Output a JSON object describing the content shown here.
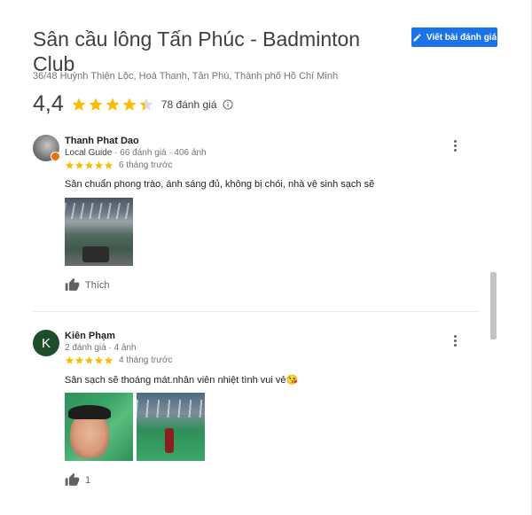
{
  "place": {
    "title": "Sân cầu lông Tấn Phúc - Badminton Club",
    "address": "36/48 Huỳnh Thiện Lộc, Hoà Thanh, Tân Phú, Thành phố Hồ Chí Minh",
    "rating": "4,4",
    "rating_stars": 4.4,
    "review_count": "78 đánh giá",
    "write_review_label": "Viết bài đánh giá"
  },
  "reviews": [
    {
      "name": "Thanh Phat Dao",
      "badge": "Local Guide",
      "meta": "· 66 đánh giá · 406 ảnh",
      "stars": 5,
      "date": "6 tháng trước",
      "text": "Sân chuẩn phong trào, ánh sáng đủ, không bị chói, nhà vệ sinh sạch sẽ",
      "photo_count": 1,
      "like_label": "Thích"
    },
    {
      "name": "Kiên Phạm",
      "avatar_letter": "K",
      "meta": "2 đánh giá · 4 ảnh",
      "stars": 5,
      "date": "4 tháng trước",
      "text": "Sân sạch sẽ thoáng mát.nhân viên nhiệt tình vui vẻ😘",
      "photo_count": 2,
      "like_label": "1"
    }
  ],
  "colors": {
    "star": "#fbbc04",
    "star_empty": "#dadce0",
    "button": "#1a73e8"
  },
  "icons": {
    "write": "pencil-icon",
    "info": "info-icon",
    "more": "more-vert-icon",
    "like": "thumb-up-icon"
  }
}
